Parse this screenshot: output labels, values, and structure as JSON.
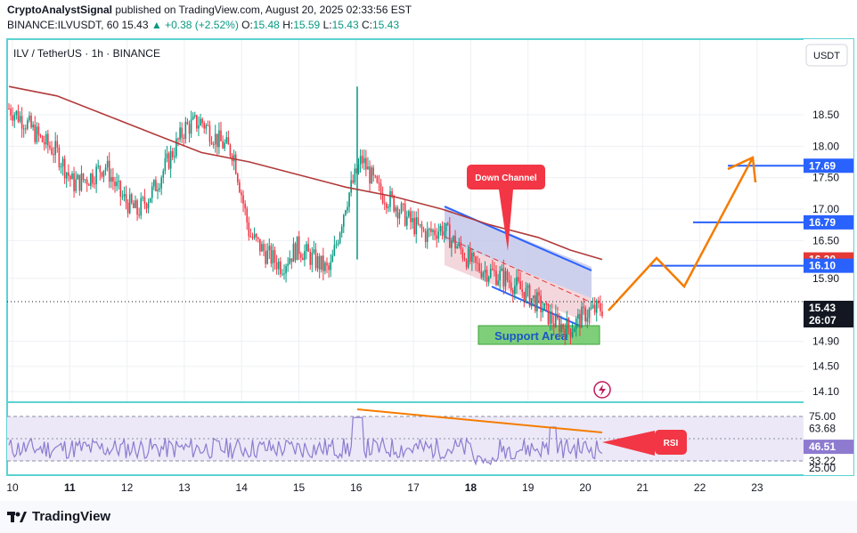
{
  "header": {
    "publisher": "CryptoAnalystSignal",
    "published_text": "published on TradingView.com, August 20, 2025 02:33:56 EST",
    "symbol": "BINANCE:ILVUSDT, 60",
    "last": "15.43",
    "change": "▲ +0.38 (+2.52%)",
    "o_label": "O:",
    "o": "15.48",
    "h_label": "H:",
    "h": "15.59",
    "l_label": "L:",
    "l": "15.43",
    "c_label": "C:",
    "c": "15.43"
  },
  "legend_title": "ILV / TetherUS · 1h · BINANCE",
  "currency_button": "USDT",
  "footer_logo": "TradingView",
  "chart_data": {
    "type": "candlestick",
    "price_axis": {
      "ticks": [
        "18.50",
        "18.00",
        "17.50",
        "17.00",
        "16.50",
        "15.90",
        "14.90",
        "14.50",
        "14.10"
      ],
      "tick_values": [
        18.5,
        18.0,
        17.5,
        17.0,
        16.5,
        15.9,
        14.9,
        14.5,
        14.1
      ],
      "ylim": [
        13.9,
        19.0
      ]
    },
    "time_axis": {
      "labels": [
        "10",
        "11",
        "12",
        "13",
        "14",
        "15",
        "16",
        "17",
        "18",
        "19",
        "20",
        "21",
        "22",
        "23"
      ],
      "bold": [
        "11",
        "18"
      ]
    },
    "price_labels": [
      {
        "value": 17.69,
        "text": "17.69",
        "color": "#2962ff"
      },
      {
        "value": 16.79,
        "text": "16.79",
        "color": "#2962ff"
      },
      {
        "value": 16.2,
        "text": "16.20",
        "color": "#e53935"
      },
      {
        "value": 16.1,
        "text": "16.10",
        "color": "#2962ff"
      },
      {
        "value": 15.43,
        "text": "15.43",
        "color": "#131722",
        "sub": "26:07"
      }
    ],
    "series": [
      {
        "name": "ILVUSDT",
        "close_path": [
          [
            0,
            18.6
          ],
          [
            1,
            18.4
          ],
          [
            2,
            18.1
          ],
          [
            3,
            17.9
          ],
          [
            4,
            17.4
          ],
          [
            5,
            17.5
          ],
          [
            6,
            17.7
          ],
          [
            7,
            17.2
          ],
          [
            8,
            16.95
          ],
          [
            9,
            17.3
          ],
          [
            10,
            17.8
          ],
          [
            11,
            18.3
          ],
          [
            12,
            18.4
          ],
          [
            13,
            18.1
          ],
          [
            14,
            17.9
          ],
          [
            15,
            16.6
          ],
          [
            16,
            16.3
          ],
          [
            17,
            16.1
          ],
          [
            18,
            16.4
          ],
          [
            19,
            16.2
          ],
          [
            20,
            16.0
          ],
          [
            21,
            17.1
          ],
          [
            22,
            17.8
          ],
          [
            23,
            17.3
          ],
          [
            24,
            17.1
          ],
          [
            25,
            16.8
          ],
          [
            26,
            16.6
          ],
          [
            27,
            16.7
          ],
          [
            28,
            16.4
          ],
          [
            29,
            16.1
          ],
          [
            30,
            16.0
          ],
          [
            31,
            15.9
          ],
          [
            32,
            15.7
          ],
          [
            33,
            15.5
          ],
          [
            34,
            15.2
          ],
          [
            35,
            15.1
          ],
          [
            36,
            15.35
          ],
          [
            37,
            15.43
          ]
        ]
      },
      {
        "name": "MA",
        "path": [
          [
            0,
            18.95
          ],
          [
            3,
            18.8
          ],
          [
            6,
            18.5
          ],
          [
            9,
            18.2
          ],
          [
            12,
            17.9
          ],
          [
            15,
            17.75
          ],
          [
            18,
            17.55
          ],
          [
            21,
            17.35
          ],
          [
            24,
            17.2
          ],
          [
            27,
            17.0
          ],
          [
            30,
            16.75
          ],
          [
            33,
            16.55
          ],
          [
            35,
            16.35
          ],
          [
            37,
            16.2
          ]
        ]
      }
    ],
    "annotations": {
      "down_channel_label": "Down Channel",
      "support_label": "Support Area",
      "rsi_label": "RSI",
      "targets": [
        16.1,
        16.79,
        17.69
      ]
    },
    "rsi_panel": {
      "ticks": [
        "75.00",
        "63.68",
        "33.22",
        "25.00"
      ],
      "tick_values": [
        75,
        63.68,
        33.22,
        25
      ],
      "current": "46.51",
      "ylim": [
        20,
        80
      ]
    }
  }
}
